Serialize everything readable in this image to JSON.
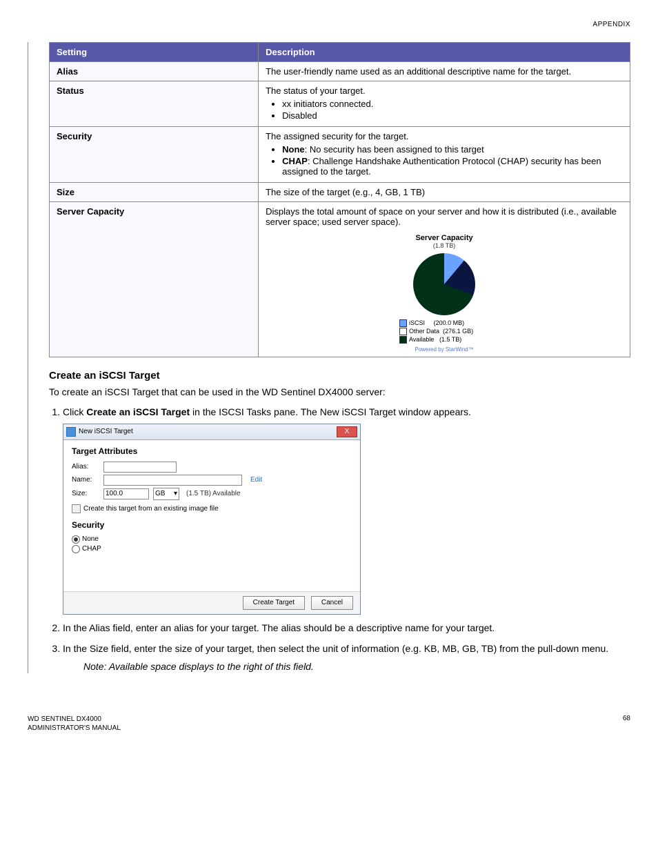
{
  "header": {
    "appendix": "APPENDIX"
  },
  "table": {
    "col1": "Setting",
    "col2": "Description",
    "rows": {
      "alias": {
        "label": "Alias",
        "desc": "The user-friendly name used as an additional descriptive name for the target."
      },
      "status": {
        "label": "Status",
        "desc": "The status of your target.",
        "b1": "xx initiators connected.",
        "b2": "Disabled"
      },
      "security": {
        "label": "Security",
        "desc": "The assigned security for the target.",
        "b1_bold": "None",
        "b1_rest": ": No security has been assigned to this target",
        "b2_bold": "CHAP",
        "b2_rest": ":  Challenge Handshake Authentication Protocol (CHAP) security has been assigned to the target."
      },
      "size": {
        "label": "Size",
        "desc": "The size of the target (e.g., 4, GB, 1 TB)"
      },
      "capacity": {
        "label": "Server Capacity",
        "desc": "Displays the total amount of space on your server and how it is distributed (i.e., available server space; used server space).",
        "chart_title": "Server Capacity",
        "chart_sub": "(1.8 TB)",
        "legend": {
          "iscsi_label": "iSCSI",
          "iscsi_val": "(200.0 MB)",
          "other_label": "Other Data",
          "other_val": "(276.1 GB)",
          "avail_label": "Available",
          "avail_val": "(1.5 TB)"
        },
        "powered": "Powered by StarWind™"
      }
    }
  },
  "section": {
    "title": "Create an iSCSI Target",
    "intro": "To create an iSCSI Target that can be used in the WD Sentinel DX4000 server:",
    "step1_a": "Click ",
    "step1_bold": "Create an iSCSI Target",
    "step1_b": " in the ISCSI Tasks pane. The New iSCSI Target window appears.",
    "step2": "In the Alias field, enter an alias for your target. The alias should be a descriptive name for your target.",
    "step3": "In the Size field, enter the size of your target, then select the unit of information (e.g. KB, MB, GB, TB) from the pull-down menu.",
    "note_label": "Note:",
    "note_text": "  Available space displays to the right of this field."
  },
  "dialog": {
    "title": "New iSCSI Target",
    "close": "X",
    "attrs_title": "Target Attributes",
    "alias_label": "Alias:",
    "name_label": "Name:",
    "edit_link": "Edit",
    "size_label": "Size:",
    "size_val": "100.0",
    "size_unit": "GB",
    "size_avail": "(1.5 TB) Available",
    "checkbox_label": "Create this target from an existing image file",
    "security_title": "Security",
    "opt_none": "None",
    "opt_chap": "CHAP",
    "btn_create": "Create Target",
    "btn_cancel": "Cancel"
  },
  "chart_data": {
    "type": "pie",
    "title": "Server Capacity",
    "subtitle": "(1.8 TB)",
    "series": [
      {
        "name": "iSCSI",
        "value": 200.0,
        "unit": "MB"
      },
      {
        "name": "Other Data",
        "value": 276.1,
        "unit": "GB"
      },
      {
        "name": "Available",
        "value": 1.5,
        "unit": "TB"
      }
    ]
  },
  "footer": {
    "line1": "WD SENTINEL DX4000",
    "line2": "ADMINISTRATOR'S MANUAL",
    "page": "68"
  }
}
